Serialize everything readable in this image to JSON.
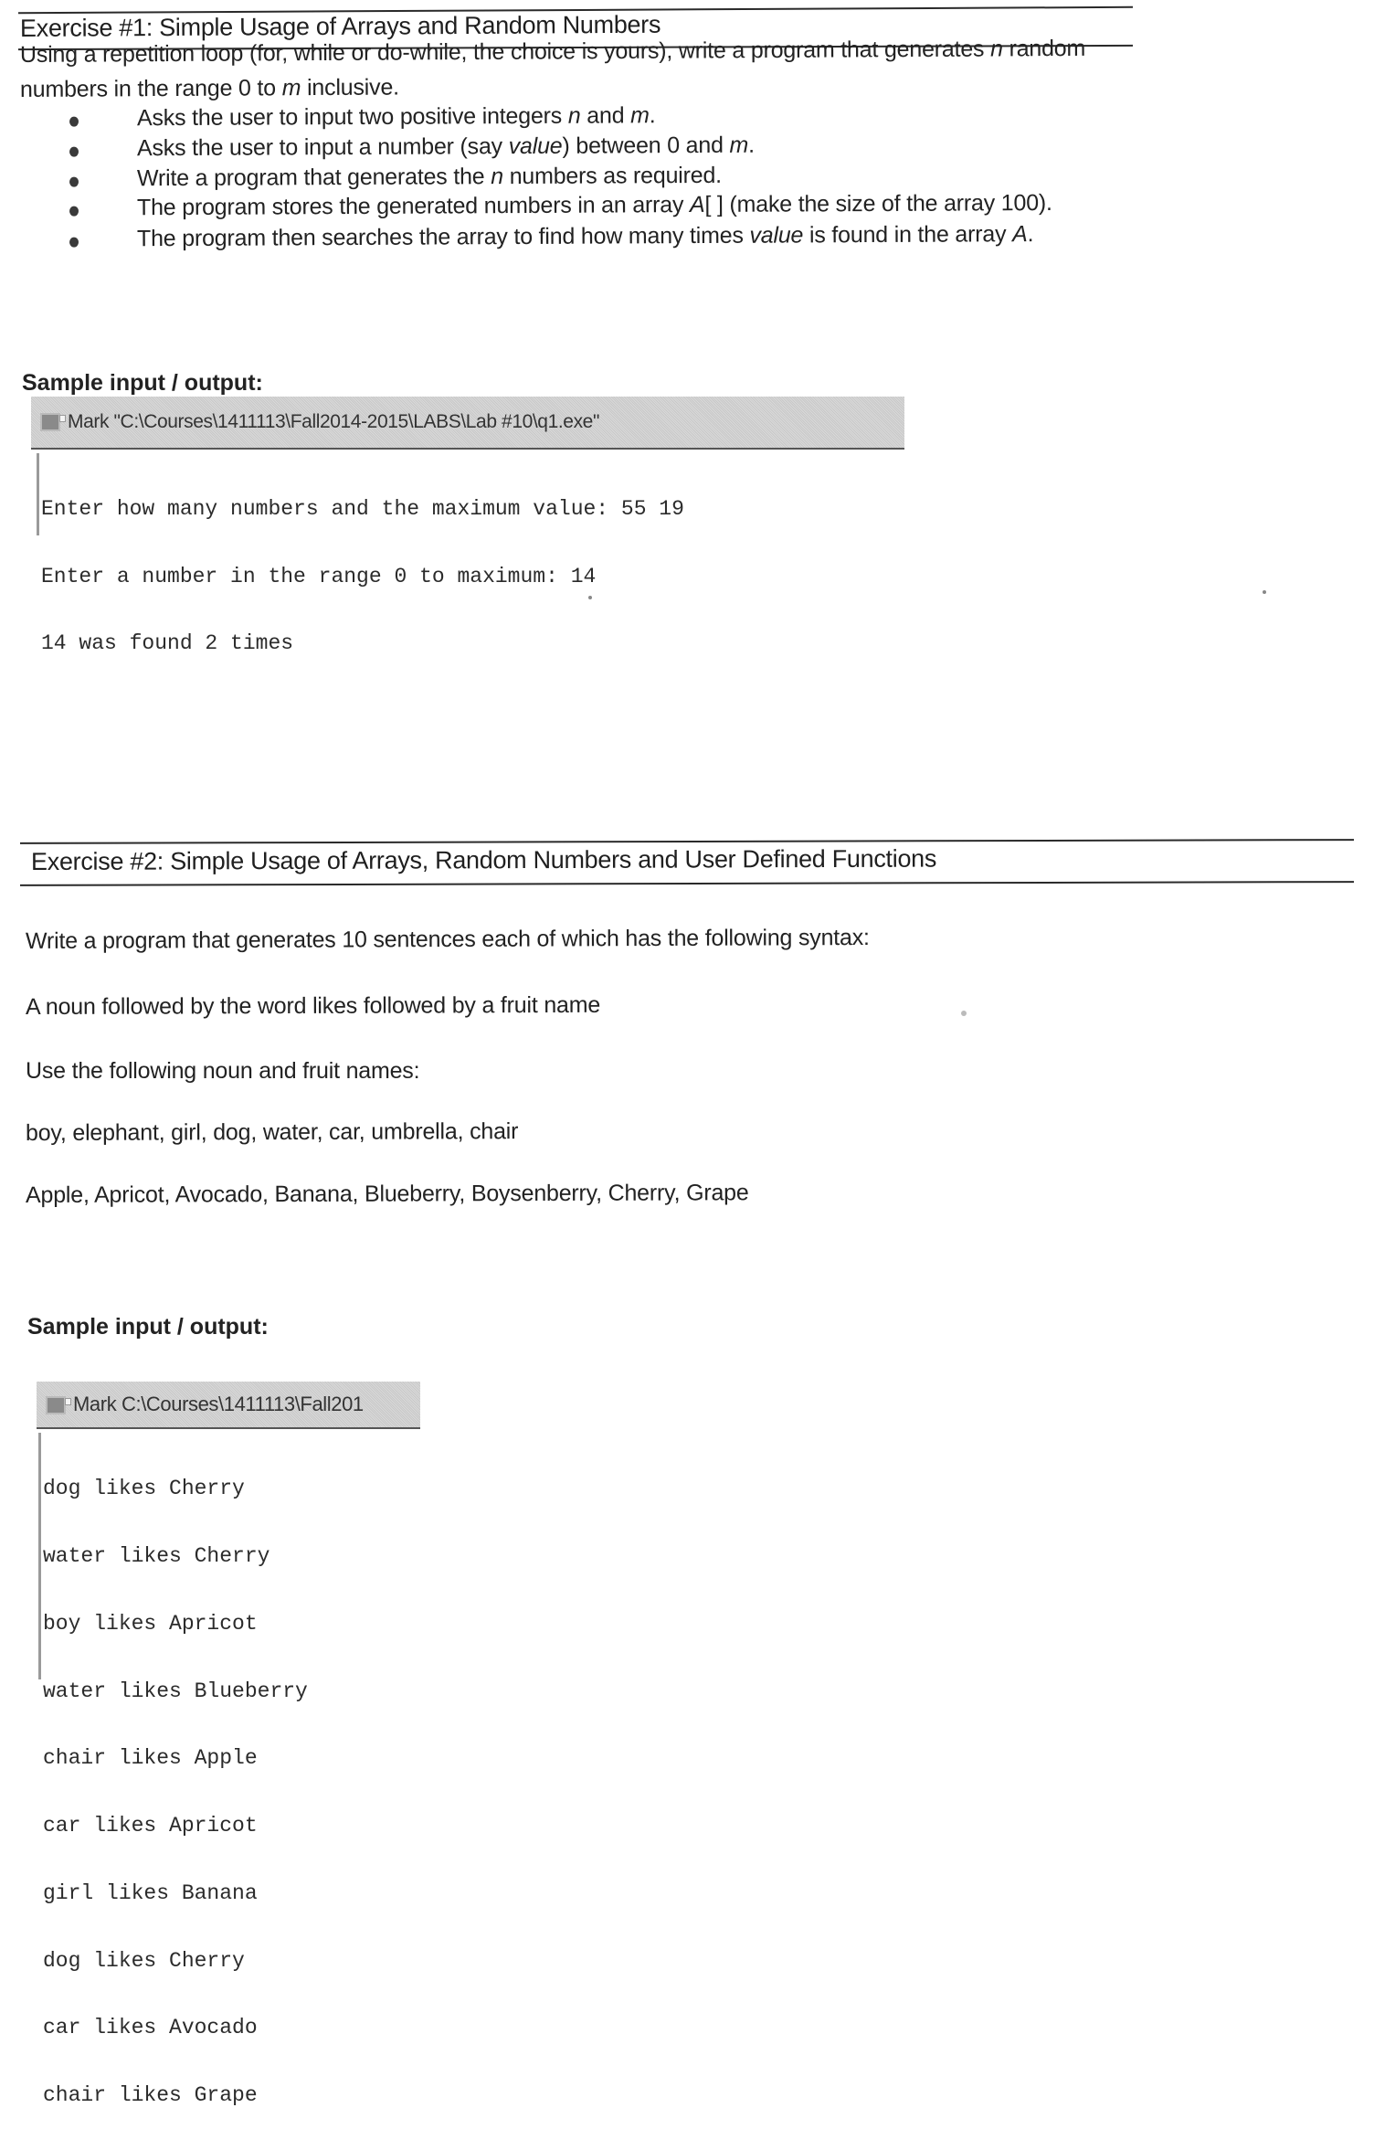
{
  "exercise1": {
    "title_lead": "Exercise #1:",
    "title_rest": " Simple Usage of Arrays and Random Numbers",
    "intro_line1_a": "Using a repetition loop (for, while or do-while, the choice is yours), write a program that generates ",
    "intro_line1_n": "n",
    "intro_line1_b": " random",
    "intro_line2_a": "numbers in the range 0 to ",
    "intro_line2_m": "m",
    "intro_line2_b": " inclusive.",
    "bullets": [
      {
        "a": "Asks the user to input two positive integers ",
        "i1": "n",
        "b": " and ",
        "i2": "m",
        "c": "."
      },
      {
        "a": "Asks the user to input a number (say ",
        "i1": "value",
        "b": ") between 0 and ",
        "i2": "m",
        "c": "."
      },
      {
        "a": "Write a program that generates the ",
        "i1": "n",
        "b": " numbers as required.",
        "i2": "",
        "c": ""
      },
      {
        "a": "The program stores the generated numbers in an array ",
        "i1": "A",
        "b": "[ ] (make the size of the array 100).",
        "i2": "",
        "c": ""
      },
      {
        "a": "The program then searches the array to find how many times ",
        "i1": "value",
        "b": " is found in the array ",
        "i2": "A",
        "c": "."
      }
    ],
    "sample_label": "Sample input / output:",
    "console": {
      "title": "Mark \"C:\\Courses\\1411113\\Fall2014-2015\\LABS\\Lab #10\\q1.exe\"",
      "lines": [
        "Enter how many numbers and the maximum value: 55 19",
        "Enter a number in the range 0 to maximum: 14",
        "14 was found 2 times"
      ]
    }
  },
  "exercise2": {
    "title_lead": "Exercise #2:",
    "title_rest": " Simple Usage of Arrays, Random Numbers and User Defined Functions",
    "paragraphs": [
      "Write a program that generates 10 sentences each of which has the following syntax:",
      "A noun followed by the word likes followed by a fruit name",
      "Use the following noun and fruit names:",
      "boy, elephant, girl, dog, water, car, umbrella, chair",
      "Apple, Apricot, Avocado, Banana, Blueberry, Boysenberry, Cherry, Grape"
    ],
    "sample_label": "Sample input / output:",
    "console": {
      "title": "Mark C:\\Courses\\1411113\\Fall201",
      "lines": [
        "dog likes Cherry",
        "water likes Cherry",
        "boy likes Apricot",
        "water likes Blueberry",
        "chair likes Apple",
        "car likes Apricot",
        "girl likes Banana",
        "dog likes Cherry",
        "car likes Avocado",
        "chair likes Grape"
      ]
    }
  }
}
